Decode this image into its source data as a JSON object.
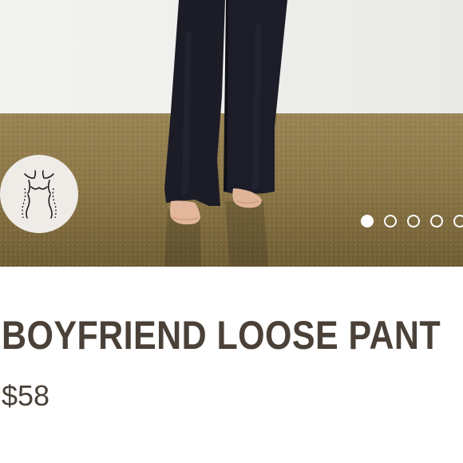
{
  "product": {
    "title": "BOYFRIEND LOOSE PANT",
    "price": "$58"
  },
  "gallery": {
    "image_description_name": "model-wearing-pants-photo",
    "dot_count": 5,
    "active_index": 0
  },
  "fit_badge": {
    "icon": "body-silhouette-icon"
  },
  "colors": {
    "text": "#4a4138",
    "badge_bg": "#efece8",
    "wall": "#ececea",
    "floor": "#8a7546",
    "pants": "#1b1c26",
    "dot": "#ffffff"
  }
}
